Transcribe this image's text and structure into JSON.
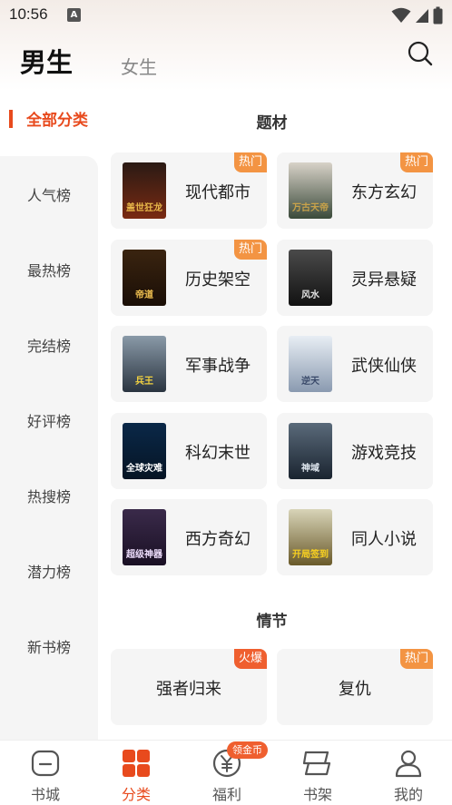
{
  "status_bar": {
    "time": "10:56",
    "notification_letter": "A"
  },
  "header": {
    "tab_male": "男生",
    "tab_female": "女生"
  },
  "sidebar": {
    "active_label": "全部分类",
    "items": [
      {
        "label": "人气榜"
      },
      {
        "label": "最热榜"
      },
      {
        "label": "完结榜"
      },
      {
        "label": "好评榜"
      },
      {
        "label": "热搜榜"
      },
      {
        "label": "潜力榜"
      },
      {
        "label": "新书榜"
      }
    ]
  },
  "sections": {
    "theme_title": "题材",
    "plot_title": "情节"
  },
  "theme_cards": [
    {
      "label": "现代都市",
      "badge": "热门",
      "cover": {
        "top": "#2a1a14",
        "bottom": "#7a2a12",
        "accent": "#e8b84a",
        "text": "盖世狂龙"
      }
    },
    {
      "label": "东方玄幻",
      "badge": "热门",
      "cover": {
        "top": "#d8d2c8",
        "bottom": "#3a4a3a",
        "accent": "#c8a24a",
        "text": "万古天帝"
      }
    },
    {
      "label": "历史架空",
      "badge": "热门",
      "cover": {
        "top": "#3a2410",
        "bottom": "#1a0e06",
        "accent": "#f0c050",
        "text": "帝道"
      }
    },
    {
      "label": "灵异悬疑",
      "badge": "",
      "cover": {
        "top": "#4a4a4a",
        "bottom": "#121212",
        "accent": "#e0e0e0",
        "text": "风水"
      }
    },
    {
      "label": "军事战争",
      "badge": "",
      "cover": {
        "top": "#8a9aa8",
        "bottom": "#2a3440",
        "accent": "#f0d040",
        "text": "兵王"
      }
    },
    {
      "label": "武侠仙侠",
      "badge": "",
      "cover": {
        "top": "#e8eef4",
        "bottom": "#8a9ab0",
        "accent": "#3a4a6a",
        "text": "逆天"
      }
    },
    {
      "label": "科幻末世",
      "badge": "",
      "cover": {
        "top": "#0a2848",
        "bottom": "#061424",
        "accent": "#ffffff",
        "text": "全球灾难"
      }
    },
    {
      "label": "游戏竞技",
      "badge": "",
      "cover": {
        "top": "#5a6a7a",
        "bottom": "#1a2430",
        "accent": "#e0e8f0",
        "text": "神域"
      }
    },
    {
      "label": "西方奇幻",
      "badge": "",
      "cover": {
        "top": "#3a2a4a",
        "bottom": "#1a1024",
        "accent": "#f0e0ff",
        "text": "超级神器"
      }
    },
    {
      "label": "同人小说",
      "badge": "",
      "cover": {
        "top": "#d8d4b8",
        "bottom": "#6a5a2a",
        "accent": "#f8d020",
        "text": "开局签到"
      }
    }
  ],
  "plot_cards": [
    {
      "label": "强者归来",
      "badge": "火爆",
      "badge_color": "#ef5f2f"
    },
    {
      "label": "复仇",
      "badge": "热门",
      "badge_color": "#f39443"
    }
  ],
  "bottom_nav": [
    {
      "label": "书城",
      "icon": "book-city-icon",
      "active": false
    },
    {
      "label": "分类",
      "icon": "category-icon",
      "active": true
    },
    {
      "label": "福利",
      "icon": "yuan-coin-icon",
      "active": false,
      "badge": "领金币"
    },
    {
      "label": "书架",
      "icon": "bookshelf-icon",
      "active": false
    },
    {
      "label": "我的",
      "icon": "profile-icon",
      "active": false
    }
  ],
  "colors": {
    "accent": "#e84a1d",
    "badge_hot": "#f39443",
    "badge_fire": "#ef5f2f",
    "card_bg": "#f5f5f5"
  }
}
